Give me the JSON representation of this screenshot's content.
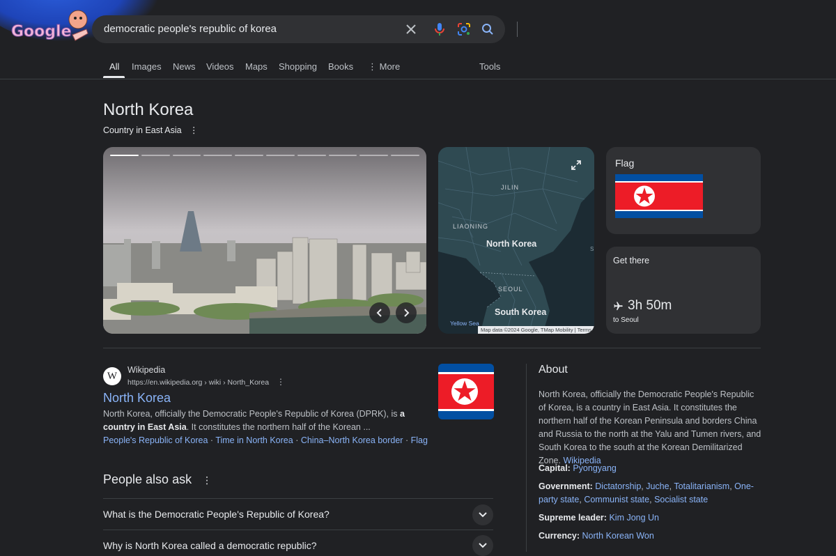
{
  "search": {
    "query": "democratic people's republic of korea"
  },
  "tabs": [
    "All",
    "Images",
    "News",
    "Videos",
    "Maps",
    "Shopping",
    "Books",
    "More",
    "Tools"
  ],
  "entity": {
    "title": "North Korea",
    "subtitle": "Country in East Asia"
  },
  "map": {
    "labels": {
      "jilin": "JILIN",
      "liaoning": "LIAONING",
      "north_korea": "North Korea",
      "seoul": "SEOUL",
      "south_korea": "South Korea",
      "yellow_sea": "Yellow Sea",
      "edge": "S"
    },
    "attribution": "Map data ©2024 Google, TMap Mobility",
    "terms": "Terms"
  },
  "flag_card": {
    "title": "Flag"
  },
  "get_there": {
    "title": "Get there",
    "time": "3h 50m",
    "destination": "to Seoul"
  },
  "result": {
    "source": "Wikipedia",
    "url": "https://en.wikipedia.org › wiki › North_Korea",
    "title": "North Korea",
    "snippet_1": "North Korea, officially the Democratic People's Republic of Korea (DPRK), is ",
    "snippet_bold": "a country in East Asia",
    "snippet_2": ". It constitutes the northern half of the Korean ...",
    "links": [
      "People's Republic of Korea",
      "Time in North Korea",
      "China–North Korea border",
      "Flag"
    ]
  },
  "paa": {
    "title": "People also ask",
    "questions": [
      "What is the Democratic People's Republic of Korea?",
      "Why is North Korea called a democratic republic?"
    ]
  },
  "about": {
    "title": "About",
    "text": "North Korea, officially the Democratic People's Republic of Korea, is a country in East Asia. It constitutes the northern half of the Korean Peninsula and borders China and Russia to the north at the Yalu and Tumen rivers, and South Korea to the south at the Korean Demilitarized Zone.",
    "source_link": "Wikipedia",
    "facts": {
      "capital_label": "Capital:",
      "capital": "Pyongyang",
      "government_label": "Government:",
      "government": [
        "Dictatorship",
        "Juche",
        "Totalitarianism",
        "One-party state",
        "Communist state",
        "Socialist state"
      ],
      "leader_label": "Supreme leader:",
      "leader": "Kim Jong Un",
      "currency_label": "Currency:",
      "currency": "North Korean Won"
    }
  },
  "colors": {
    "background": "#202124",
    "card": "#303134",
    "link": "#8ab4f8",
    "flag_red": "#ED1C27",
    "flag_blue": "#024FA2"
  }
}
